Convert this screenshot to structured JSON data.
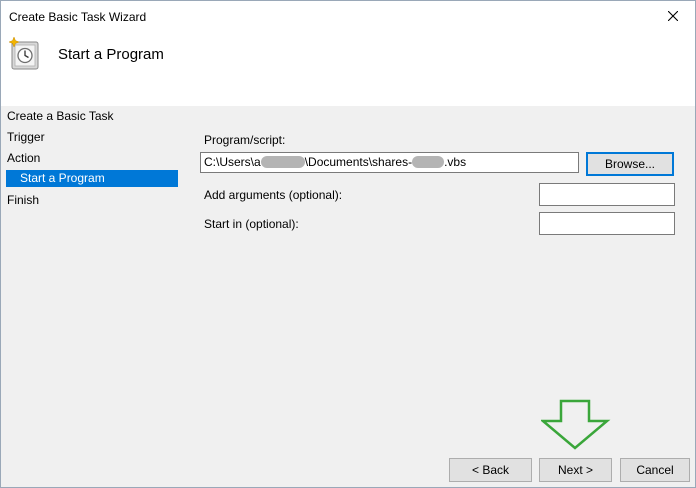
{
  "window": {
    "title": "Create Basic Task Wizard"
  },
  "header": {
    "title": "Start a Program"
  },
  "nav": {
    "items": [
      {
        "label": "Create a Basic Task",
        "selected": false
      },
      {
        "label": "Trigger",
        "selected": false
      },
      {
        "label": "Action",
        "selected": false
      },
      {
        "label": "Start a Program",
        "selected": true
      },
      {
        "label": "Finish",
        "selected": false
      }
    ]
  },
  "form": {
    "program_label": "Program/script:",
    "program_value_prefix": "C:\\Users\\a",
    "program_value_middle": "\\Documents\\shares-",
    "program_value_suffix": ".vbs",
    "browse_label": "Browse...",
    "arguments_label": "Add arguments (optional):",
    "arguments_value": "",
    "start_in_label": "Start in (optional):",
    "start_in_value": ""
  },
  "footer": {
    "back_label": "< Back",
    "next_label": "Next >",
    "cancel_label": "Cancel"
  },
  "colors": {
    "selection": "#0078d7",
    "annotation_arrow": "#3aa63a"
  }
}
